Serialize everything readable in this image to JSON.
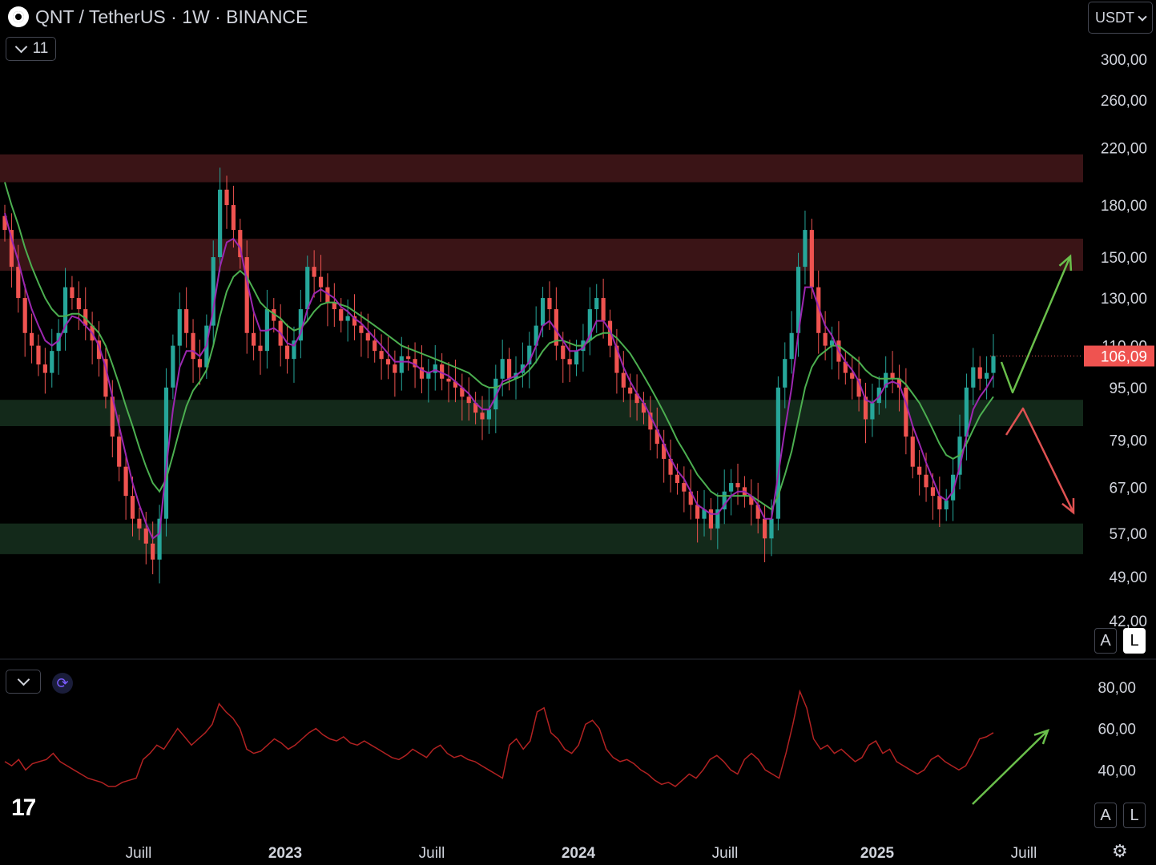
{
  "header": {
    "title": "QNT / TetherUS · 1W · BINANCE",
    "indicator_count": "11",
    "currency": "USDT"
  },
  "buttons": {
    "auto": "A",
    "log": "L"
  },
  "colors": {
    "up": "#26a69a",
    "down": "#ef5350",
    "resistance_zone": "#3a1416",
    "support_zone": "#13291a",
    "ma_fast": "#9c27b0",
    "ma_slow": "#4caf50",
    "rsi": "#b22222",
    "arrow_up": "#6abf4b",
    "arrow_down": "#e05252"
  },
  "chart_data": [
    {
      "type": "candlestick",
      "title": "QNT / TetherUS · 1W · BINANCE",
      "scale": "log",
      "ylim": [
        37,
        330
      ],
      "y_ticks": [
        "300,00",
        "260,00",
        "220,00",
        "180,00",
        "150,00",
        "130,00",
        "110,00",
        "95,00",
        "79,00",
        "67,00",
        "57,00",
        "49,00",
        "42,00"
      ],
      "x_ticks": [
        "Juill",
        "2023",
        "Juill",
        "2024",
        "Juill",
        "2025",
        "Juill"
      ],
      "last_price": "106,09",
      "close_prices": [
        165,
        145,
        130,
        115,
        110,
        103,
        100,
        108,
        115,
        135,
        130,
        125,
        118,
        112,
        105,
        92,
        80,
        72,
        65,
        60,
        58,
        55,
        52,
        60,
        95,
        110,
        125,
        115,
        105,
        102,
        118,
        150,
        190,
        180,
        165,
        150,
        115,
        110,
        108,
        125,
        120,
        110,
        105,
        112,
        125,
        145,
        140,
        135,
        128,
        125,
        120,
        122,
        118,
        115,
        112,
        108,
        105,
        103,
        100,
        106,
        105,
        102,
        98,
        100,
        103,
        98,
        97,
        95,
        92,
        90,
        87,
        85,
        88,
        98,
        105,
        98,
        100,
        103,
        110,
        118,
        130,
        125,
        110,
        105,
        103,
        108,
        112,
        125,
        130,
        120,
        110,
        100,
        95,
        93,
        90,
        87,
        82,
        78,
        74,
        70,
        68,
        66,
        63,
        60,
        62,
        58,
        62,
        66,
        68,
        67,
        65,
        63,
        60,
        56,
        60,
        95,
        105,
        115,
        145,
        165,
        135,
        115,
        110,
        112,
        104,
        100,
        98,
        92,
        85,
        90,
        95,
        100,
        98,
        95,
        80,
        72,
        70,
        67,
        65,
        62,
        64,
        70,
        80,
        95,
        102,
        98,
        100,
        106.09
      ],
      "ma_fast_values": [
        175,
        160,
        148,
        135,
        125,
        118,
        112,
        110,
        112,
        118,
        122,
        121,
        118,
        115,
        110,
        102,
        92,
        83,
        75,
        68,
        63,
        59,
        56,
        57,
        72,
        88,
        102,
        108,
        108,
        106,
        110,
        125,
        145,
        158,
        160,
        155,
        138,
        124,
        116,
        116,
        117,
        115,
        111,
        110,
        115,
        125,
        132,
        134,
        132,
        130,
        126,
        124,
        121,
        119,
        116,
        113,
        110,
        107,
        104,
        104,
        104,
        103,
        101,
        100,
        101,
        100,
        99,
        97,
        95,
        93,
        90,
        88,
        88,
        92,
        97,
        98,
        99,
        101,
        104,
        110,
        118,
        120,
        116,
        112,
        108,
        108,
        109,
        114,
        120,
        120,
        116,
        109,
        102,
        97,
        93,
        90,
        86,
        82,
        78,
        74,
        71,
        69,
        66,
        63,
        62,
        61,
        61,
        63,
        65,
        66,
        66,
        65,
        63,
        60,
        60,
        70,
        82,
        95,
        115,
        135,
        135,
        126,
        118,
        114,
        108,
        104,
        101,
        97,
        91,
        90,
        92,
        96,
        97,
        96,
        90,
        83,
        78,
        73,
        69,
        65,
        64,
        66,
        72,
        80,
        88,
        92,
        95,
        99
      ],
      "ma_slow_values": [
        195,
        180,
        168,
        155,
        145,
        137,
        130,
        125,
        122,
        122,
        123,
        123,
        121,
        118,
        115,
        110,
        103,
        96,
        89,
        83,
        77,
        72,
        68,
        66,
        69,
        75,
        82,
        89,
        94,
        97,
        101,
        110,
        122,
        133,
        140,
        143,
        140,
        134,
        128,
        125,
        123,
        121,
        118,
        116,
        117,
        120,
        124,
        127,
        128,
        128,
        127,
        126,
        124,
        122,
        120,
        118,
        116,
        114,
        112,
        110,
        109,
        108,
        107,
        106,
        105,
        104,
        103,
        102,
        101,
        100,
        98,
        96,
        95,
        95,
        96,
        97,
        98,
        99,
        101,
        104,
        108,
        111,
        112,
        112,
        111,
        110,
        110,
        112,
        114,
        115,
        115,
        113,
        110,
        107,
        103,
        99,
        95,
        91,
        87,
        83,
        79,
        76,
        73,
        70,
        68,
        66,
        65,
        65,
        65,
        65,
        65,
        65,
        64,
        63,
        62,
        65,
        70,
        76,
        85,
        95,
        102,
        106,
        108,
        110,
        110,
        108,
        106,
        104,
        101,
        99,
        98,
        98,
        98,
        98,
        96,
        93,
        90,
        86,
        82,
        78,
        75,
        74,
        75,
        78,
        82,
        86,
        89,
        92
      ],
      "zones": [
        {
          "kind": "resistance",
          "from": 195,
          "to": 215
        },
        {
          "kind": "resistance",
          "from": 143,
          "to": 160
        },
        {
          "kind": "support",
          "from": 83,
          "to": 91
        },
        {
          "kind": "support",
          "from": 53,
          "to": 59
        }
      ]
    },
    {
      "type": "line",
      "series": [
        {
          "values": [
            44,
            42,
            45,
            40,
            43,
            44,
            45,
            48,
            44,
            42,
            40,
            38,
            36,
            35,
            34,
            32,
            32,
            34,
            35,
            36,
            45,
            48,
            52,
            50,
            55,
            60,
            56,
            52,
            55,
            58,
            62,
            72,
            68,
            65,
            60,
            50,
            48,
            49,
            52,
            55,
            53,
            50,
            52,
            55,
            58,
            60,
            57,
            55,
            54,
            56,
            53,
            52,
            54,
            52,
            50,
            48,
            46,
            45,
            47,
            50,
            48,
            46,
            50,
            52,
            48,
            46,
            47,
            45,
            44,
            42,
            40,
            38,
            36,
            52,
            55,
            50,
            54,
            68,
            70,
            58,
            55,
            50,
            48,
            52,
            62,
            64,
            60,
            50,
            46,
            44,
            45,
            43,
            40,
            38,
            35,
            33,
            34,
            32,
            35,
            38,
            36,
            40,
            45,
            47,
            44,
            40,
            38,
            45,
            48,
            45,
            40,
            38,
            36,
            48,
            62,
            78,
            70,
            55,
            50,
            52,
            48,
            50,
            47,
            44,
            46,
            52,
            54,
            48,
            50,
            44,
            42,
            40,
            38,
            40,
            45,
            47,
            44,
            42,
            40,
            42,
            48,
            55,
            56,
            58
          ]
        }
      ],
      "y_ticks": [
        "80,00",
        "60,00",
        "40,00"
      ],
      "ylim": [
        25,
        85
      ]
    }
  ]
}
